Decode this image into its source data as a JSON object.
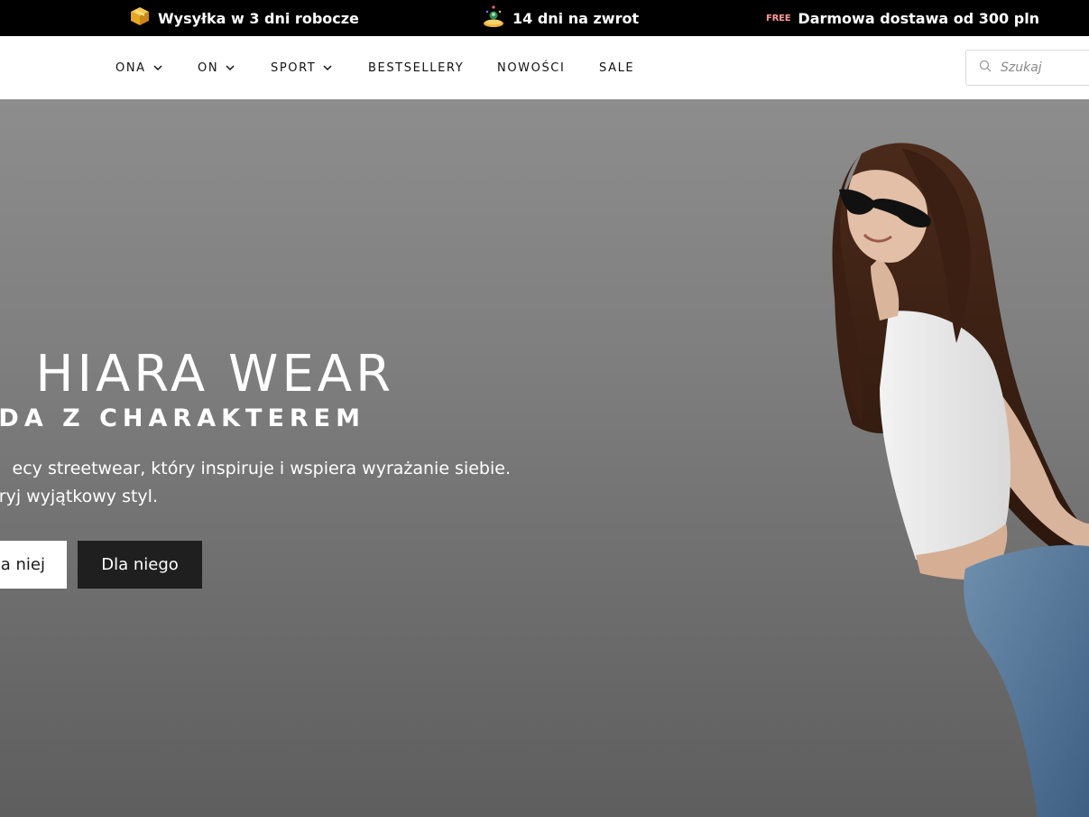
{
  "announcement": {
    "items": [
      {
        "icon": "package-icon",
        "text": "Wysyłka w 3 dni robocze"
      },
      {
        "icon": "return-icon",
        "text": "14 dni na zwrot"
      },
      {
        "icon": "free-shipping-icon",
        "badge": "FREE",
        "text": "Darmowa dostawa od 300 pln"
      }
    ]
  },
  "nav": {
    "items": [
      {
        "label": "ONA",
        "has_dropdown": true
      },
      {
        "label": "ON",
        "has_dropdown": true
      },
      {
        "label": "SPORT",
        "has_dropdown": true
      },
      {
        "label": "BESTSELLERY",
        "has_dropdown": false
      },
      {
        "label": "NOWOŚCI",
        "has_dropdown": false
      },
      {
        "label": "SALE",
        "has_dropdown": false
      }
    ],
    "search": {
      "placeholder": "Szukaj",
      "icon": "search-icon"
    }
  },
  "hero": {
    "title": "HIARA WEAR",
    "subtitle": "ODA Z CHARAKTEREM",
    "description_line1": "ecy streetwear, który inspiruje i wspiera wyrażanie siebie.",
    "description_line2": "ryj wyjątkowy styl.",
    "button_her": "a niej",
    "button_him": "Dla niego"
  },
  "colors": {
    "topbar_bg": "#000000",
    "hero_bg": "#7f7f7f",
    "button_dark": "#1f1f1f",
    "button_light": "#ffffff"
  }
}
